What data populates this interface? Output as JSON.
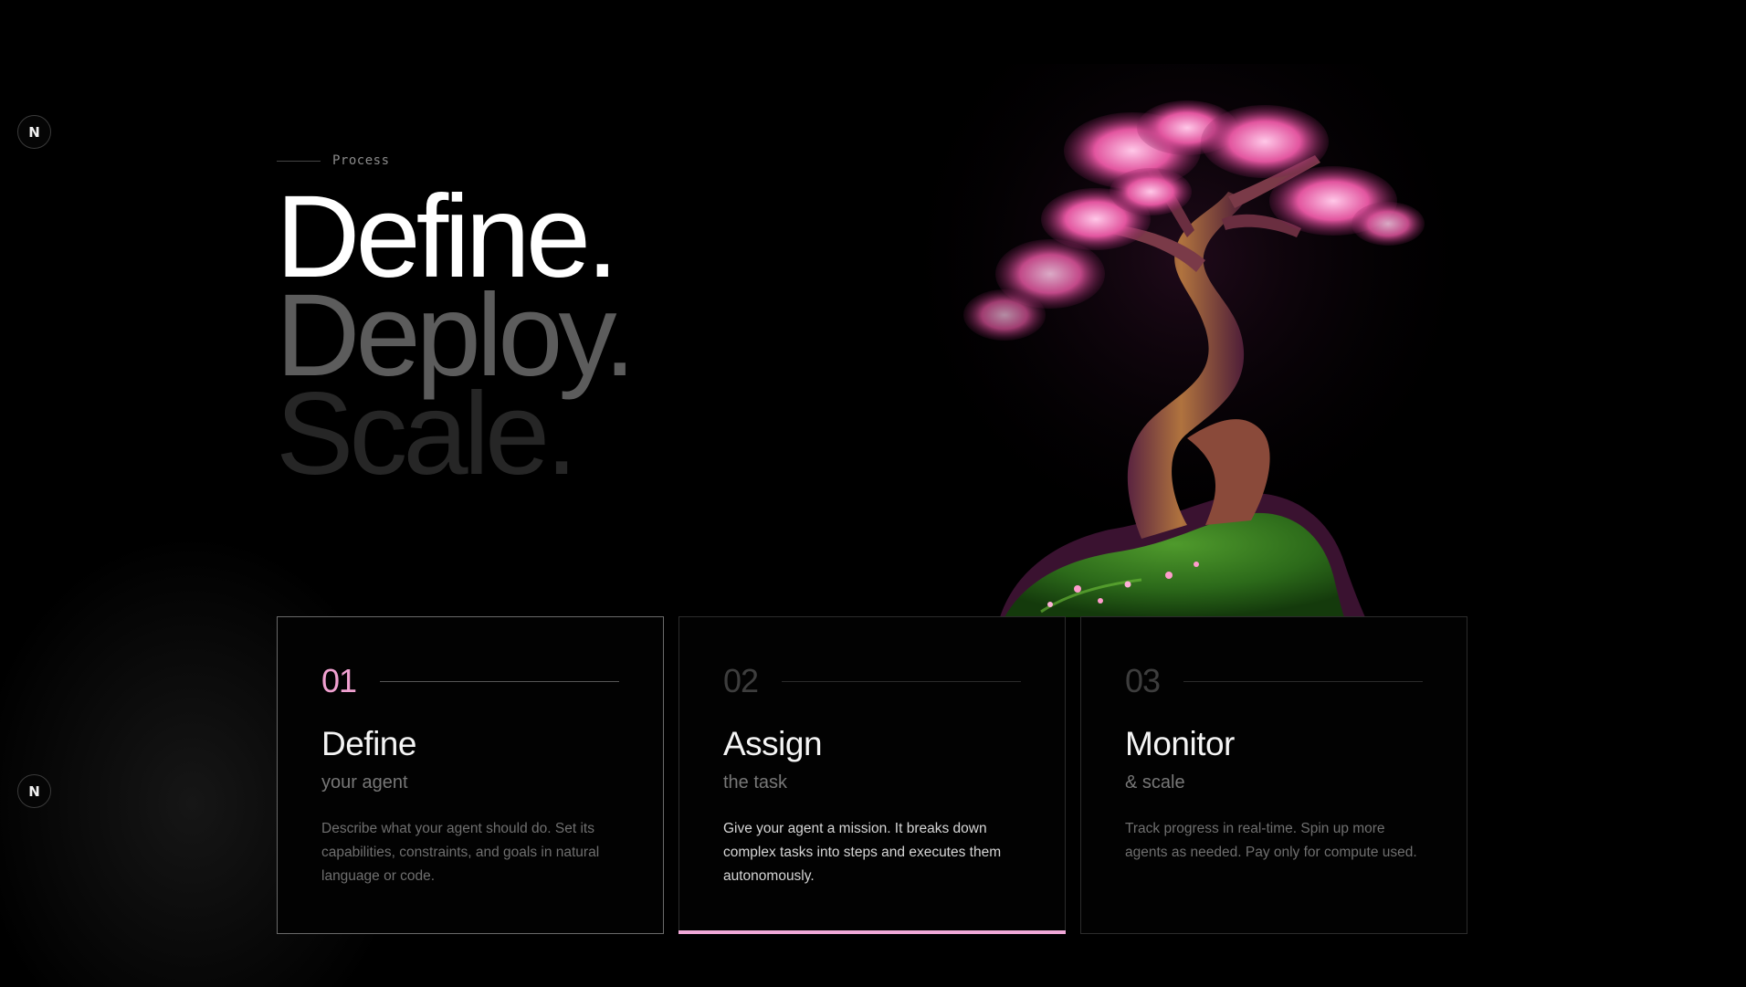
{
  "brand": {
    "logo_letter_top": "N",
    "logo_letter_bottom": "N"
  },
  "section": {
    "eyebrow": "Process"
  },
  "headline": {
    "line1": "Define.",
    "line2": "Deploy.",
    "line3": "Scale."
  },
  "cards": [
    {
      "number": "01",
      "title": "Define",
      "subtitle": "your agent",
      "description": "Describe what your agent should do. Set its capabilities, constraints, and goals in natural language or code."
    },
    {
      "number": "02",
      "title": "Assign",
      "subtitle": "the task",
      "description": "Give your agent a mission. It breaks down complex tasks into steps and executes them autonomously."
    },
    {
      "number": "03",
      "title": "Monitor",
      "subtitle": "& scale",
      "description": "Track progress in real-time. Spin up more agents as needed. Pay only for compute used."
    }
  ],
  "colors": {
    "accent_pink": "#f0a8d8",
    "background": "#000000"
  },
  "icons": {
    "hero_image": "bonsai-tree-illustration"
  }
}
